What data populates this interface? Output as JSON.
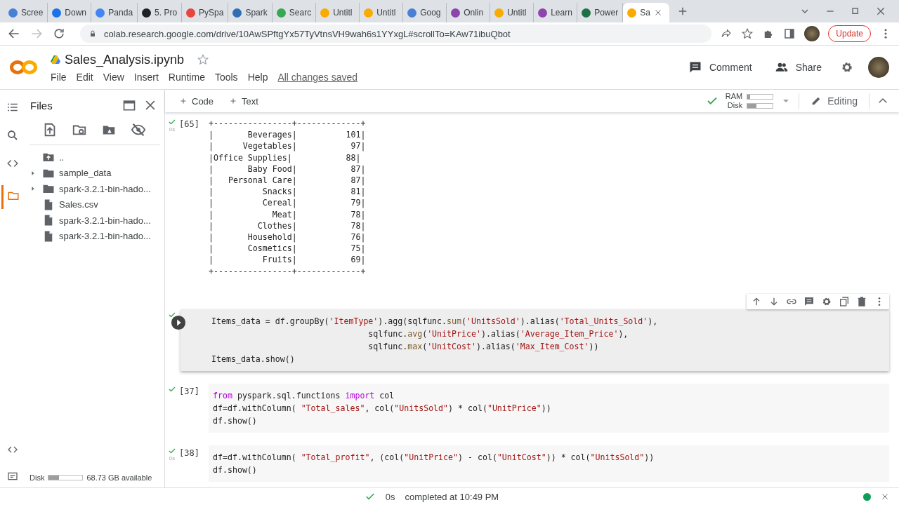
{
  "browser": {
    "tabs": [
      {
        "title": "Scree",
        "color": "#4a7fd6",
        "selected": false
      },
      {
        "title": "Down",
        "color": "#1a73e8",
        "selected": false
      },
      {
        "title": "Panda",
        "color": "#4285f4",
        "selected": false
      },
      {
        "title": "5. Pro",
        "color": "#202124",
        "selected": false
      },
      {
        "title": "PySpa",
        "color": "#e8453c",
        "selected": false
      },
      {
        "title": "Spark",
        "color": "#2f6db5",
        "selected": false
      },
      {
        "title": "Searc",
        "color": "#34a853",
        "selected": false
      },
      {
        "title": "Untitl",
        "color": "#f9ab00",
        "selected": false
      },
      {
        "title": "Untitl",
        "color": "#f9ab00",
        "selected": false
      },
      {
        "title": "Goog",
        "color": "#4a7fd6",
        "selected": false
      },
      {
        "title": "Onlin",
        "color": "#8e44ad",
        "selected": false
      },
      {
        "title": "Untitl",
        "color": "#f9ab00",
        "selected": false
      },
      {
        "title": "Learn",
        "color": "#8e44ad",
        "selected": false
      },
      {
        "title": "Power",
        "color": "#1e7145",
        "selected": false
      },
      {
        "title": "Sa",
        "color": "#f9ab00",
        "selected": true
      }
    ],
    "url": "colab.research.google.com/drive/10AwSPftgYx57TyVtnsVH9wah6s1YYxgL#scrollTo=KAw71ibuQbot",
    "update": "Update"
  },
  "notebook": {
    "title": "Sales_Analysis.ipynb",
    "menu": [
      "File",
      "Edit",
      "View",
      "Insert",
      "Runtime",
      "Tools",
      "Help"
    ],
    "save_status": "All changes saved",
    "comment": "Comment",
    "share": "Share"
  },
  "toolbar": {
    "add": [
      "Code",
      "Text"
    ],
    "resources": [
      {
        "label": "RAM",
        "level": 0.1
      },
      {
        "label": "Disk",
        "level": 0.35
      }
    ],
    "mode": "Editing"
  },
  "sidebar": {
    "title": "Files",
    "files": [
      {
        "name": "..",
        "kind": "up"
      },
      {
        "name": "sample_data",
        "kind": "folder",
        "expanded": false
      },
      {
        "name": "spark-3.2.1-bin-hado...",
        "kind": "folder",
        "expanded": false
      },
      {
        "name": "Sales.csv",
        "kind": "file"
      },
      {
        "name": "spark-3.2.1-bin-hado...",
        "kind": "file"
      },
      {
        "name": "spark-3.2.1-bin-hado...",
        "kind": "file"
      }
    ],
    "disk": {
      "label": "Disk",
      "level": 0.3,
      "text": "68.73 GB available"
    }
  },
  "cells": [
    {
      "kind": "output",
      "count": "[65]",
      "time": "0s",
      "output": [
        "+----------------+-------------+",
        "|       Beverages|          101|",
        "|      Vegetables|           97|",
        "|Office Supplies|           88|",
        "|       Baby Food|           87|",
        "|   Personal Care|           87|",
        "|          Snacks|           81|",
        "|          Cereal|           79|",
        "|            Meat|           78|",
        "|         Clothes|           78|",
        "|       Household|           76|",
        "|       Cosmetics|           75|",
        "|          Fruits|           69|",
        "+----------------+-------------+"
      ]
    },
    {
      "kind": "code",
      "focused": true,
      "code": [
        [
          {
            "kind": "plain",
            "text": "Items_data = df.groupBy("
          },
          {
            "kind": "str",
            "text": "'ItemType'"
          },
          {
            "kind": "plain",
            "text": ").agg(sqlfunc."
          },
          {
            "kind": "fn",
            "text": "sum"
          },
          {
            "kind": "plain",
            "text": "("
          },
          {
            "kind": "str",
            "text": "'UnitsSold'"
          },
          {
            "kind": "plain",
            "text": ").alias("
          },
          {
            "kind": "str",
            "text": "'Total_Units_Sold'"
          },
          {
            "kind": "plain",
            "text": "),"
          }
        ],
        [
          {
            "kind": "plain",
            "text": "                                sqlfunc."
          },
          {
            "kind": "fn",
            "text": "avg"
          },
          {
            "kind": "plain",
            "text": "("
          },
          {
            "kind": "str",
            "text": "'UnitPrice'"
          },
          {
            "kind": "plain",
            "text": ").alias("
          },
          {
            "kind": "str",
            "text": "'Average_Item_Price'"
          },
          {
            "kind": "plain",
            "text": "),"
          }
        ],
        [
          {
            "kind": "plain",
            "text": "                                sqlfunc."
          },
          {
            "kind": "fn",
            "text": "max"
          },
          {
            "kind": "plain",
            "text": "("
          },
          {
            "kind": "str",
            "text": "'UnitCost'"
          },
          {
            "kind": "plain",
            "text": ").alias("
          },
          {
            "kind": "str",
            "text": "'Max_Item_Cost'"
          },
          {
            "kind": "plain",
            "text": "))"
          }
        ],
        [
          {
            "kind": "plain",
            "text": "Items_data.show()"
          }
        ]
      ]
    },
    {
      "kind": "code",
      "focused": false,
      "count": "[37]",
      "code": [
        [
          {
            "kind": "kw",
            "text": "from"
          },
          {
            "kind": "plain",
            "text": " pyspark.sql.functions "
          },
          {
            "kind": "kw",
            "text": "import"
          },
          {
            "kind": "plain",
            "text": " col"
          }
        ],
        [
          {
            "kind": "plain",
            "text": "df=df.withColumn( "
          },
          {
            "kind": "str",
            "text": "\"Total_sales\""
          },
          {
            "kind": "plain",
            "text": ", col("
          },
          {
            "kind": "str",
            "text": "\"UnitsSold\""
          },
          {
            "kind": "plain",
            "text": ") * col("
          },
          {
            "kind": "str",
            "text": "\"UnitPrice\""
          },
          {
            "kind": "plain",
            "text": "))"
          }
        ],
        [
          {
            "kind": "plain",
            "text": "df.show()"
          }
        ]
      ]
    },
    {
      "kind": "code",
      "focused": false,
      "count": "[38]",
      "time": "0s",
      "code": [
        [
          {
            "kind": "plain",
            "text": "df=df.withColumn( "
          },
          {
            "kind": "str",
            "text": "\"Total_profit\""
          },
          {
            "kind": "plain",
            "text": ", (col("
          },
          {
            "kind": "str",
            "text": "\"UnitPrice\""
          },
          {
            "kind": "plain",
            "text": ") - col("
          },
          {
            "kind": "str",
            "text": "\"UnitCost\""
          },
          {
            "kind": "plain",
            "text": ")) * col("
          },
          {
            "kind": "str",
            "text": "\"UnitsSold\""
          },
          {
            "kind": "plain",
            "text": "))"
          }
        ],
        [
          {
            "kind": "plain",
            "text": "df.show()"
          }
        ]
      ]
    }
  ],
  "status_bar": {
    "time": "0s",
    "text": "completed at 10:49 PM"
  }
}
